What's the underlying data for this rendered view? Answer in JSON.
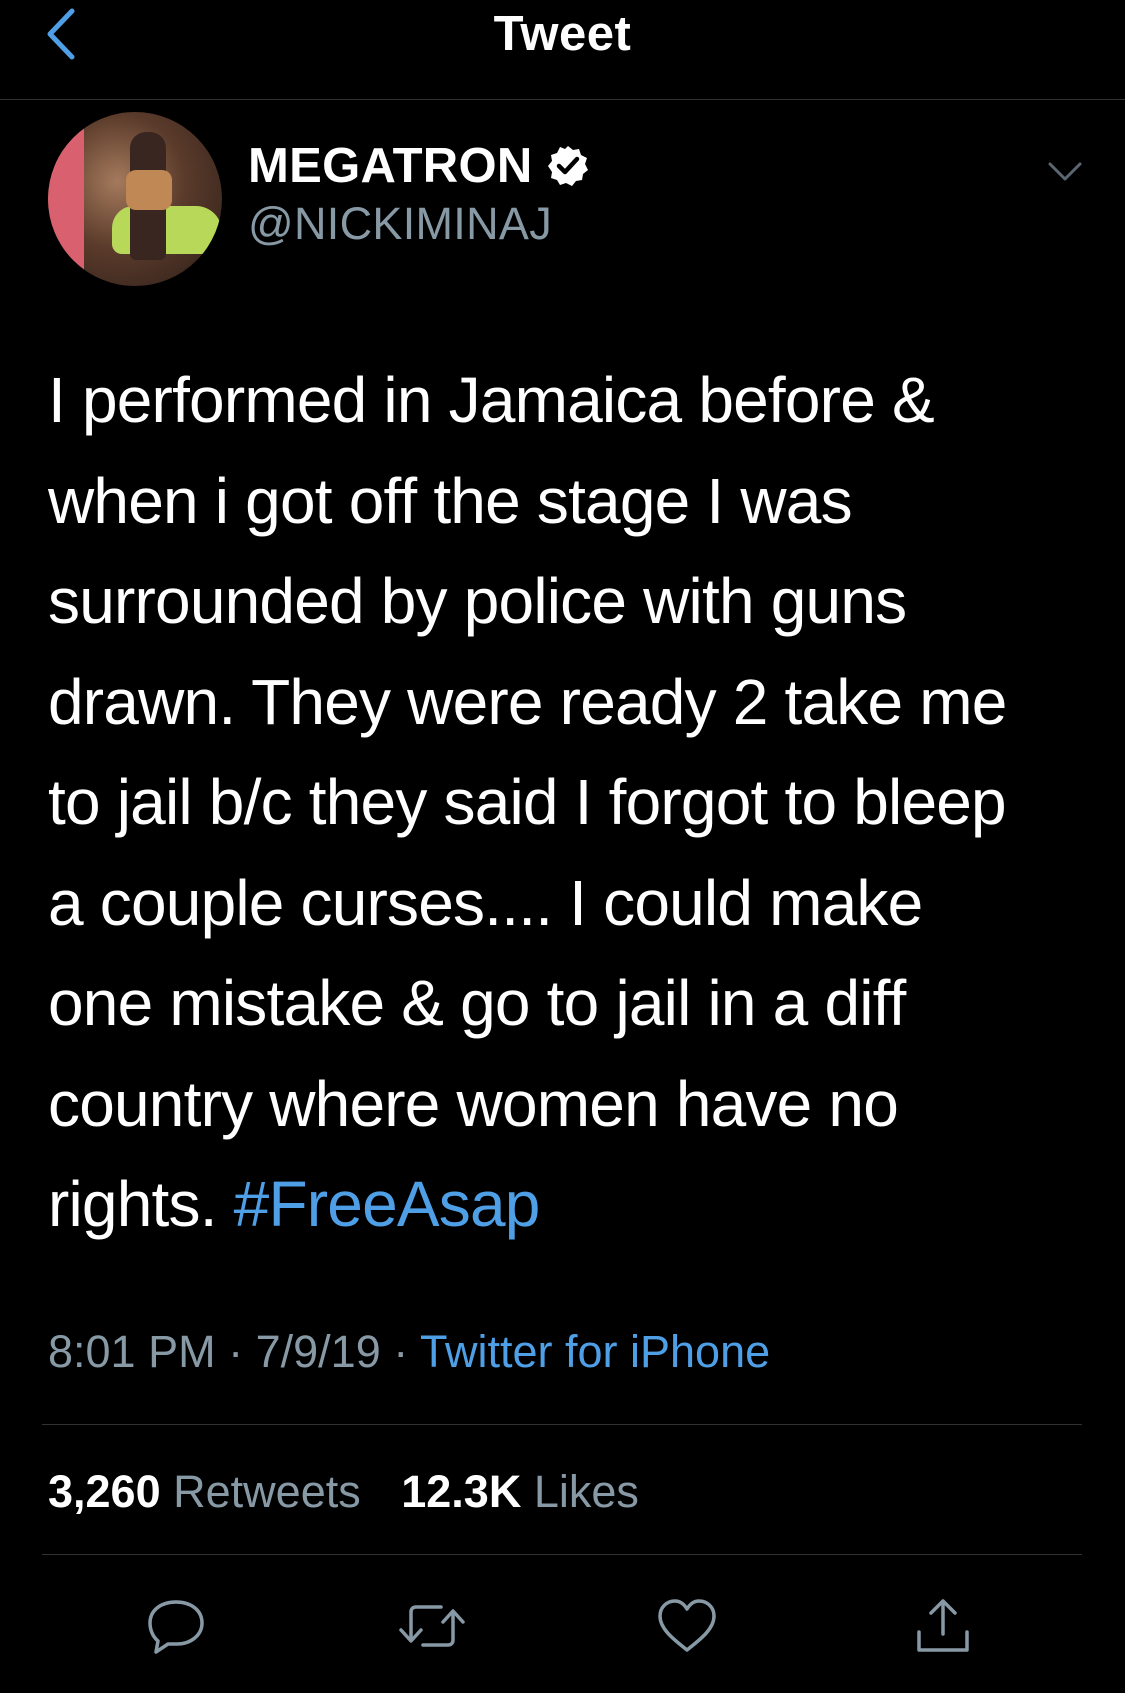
{
  "nav": {
    "title": "Tweet",
    "back_icon": "chevron-left-icon"
  },
  "author": {
    "display_name": "MEGATRON",
    "handle": "@NICKIMINAJ",
    "verified": true
  },
  "tweet": {
    "lines": [
      "I performed in Jamaica before &",
      "when i got off the stage I was",
      "surrounded by police with guns",
      "drawn. They were ready 2 take me",
      "to jail b/c they said I forgot to bleep",
      "a couple curses.... I could make",
      "one mistake & go to jail in a diff",
      "country where women have no",
      "rights."
    ],
    "hashtag": "#FreeAsap"
  },
  "meta": {
    "time": "8:01 PM",
    "date": "7/9/19",
    "separator": "·",
    "source": "Twitter for iPhone"
  },
  "stats": {
    "retweets_count": "3,260",
    "retweets_label": "Retweets",
    "likes_count": "12.3K",
    "likes_label": "Likes"
  },
  "actions": [
    "reply-icon",
    "retweet-icon",
    "like-icon",
    "share-icon"
  ],
  "colors": {
    "background": "#000000",
    "link_blue": "#4f9fe6",
    "secondary_text": "#8899a6",
    "divider": "#2f3336"
  }
}
